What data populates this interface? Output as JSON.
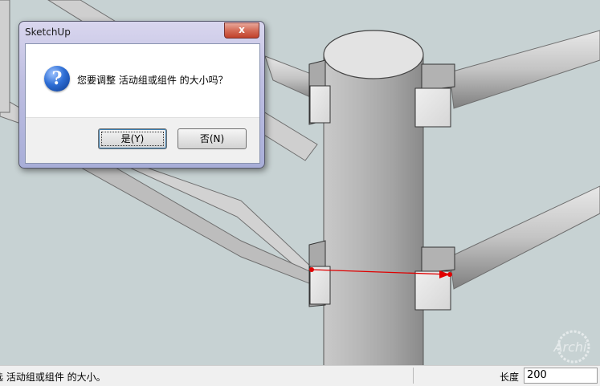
{
  "dialog": {
    "title": "SketchUp",
    "close_glyph": "x",
    "message": "您要调整 活动组或组件 的大小吗？",
    "icon": "question-icon",
    "yes_label": "是(Y)",
    "no_label": "否(N)"
  },
  "statusbar": {
    "text": "选 活动组或组件 的大小。",
    "measure_label": "长度",
    "measure_value": "200"
  },
  "watermark": {
    "text": "Archi"
  },
  "colors": {
    "background": "#c7d2d3",
    "measure_line": "#e00000",
    "close_button": "#c9462f"
  }
}
